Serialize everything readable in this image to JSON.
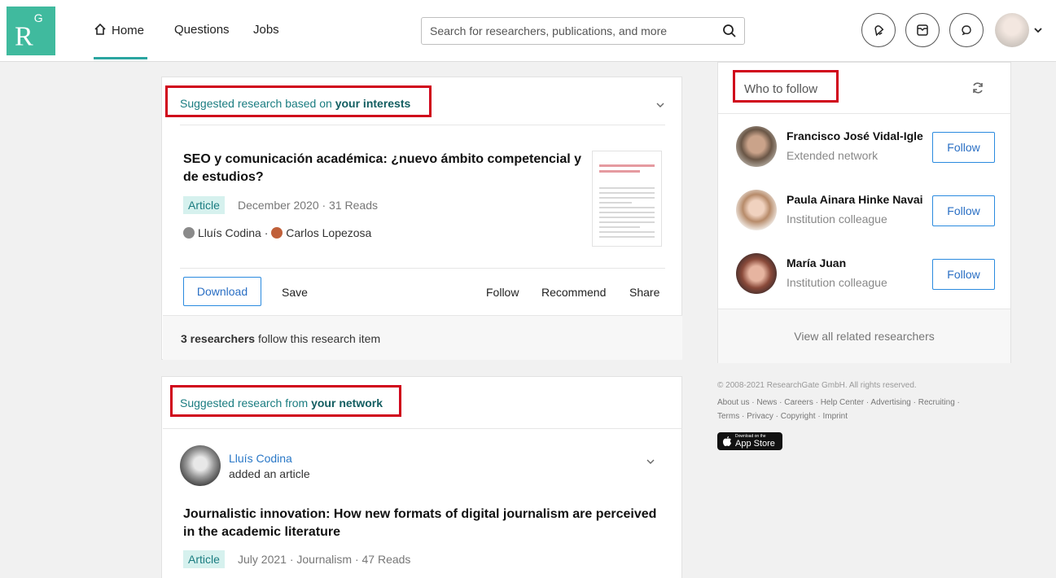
{
  "nav": {
    "logo": "R",
    "logo_sup": "G",
    "home": "Home",
    "questions": "Questions",
    "jobs": "Jobs",
    "search_placeholder": "Search for researchers, publications, and more"
  },
  "card_interests": {
    "header_prefix": "Suggested research based on ",
    "header_bold": "your interests",
    "title": "SEO y comunicación académica: ¿nuevo ámbito competencial y de estudios?",
    "tag": "Article",
    "meta": "December 2020 · 31 Reads",
    "author1": "Lluís Codina",
    "separator": " · ",
    "author2": "Carlos Lopezosa",
    "download": "Download",
    "save": "Save",
    "follow": "Follow",
    "recommend": "Recommend",
    "share": "Share",
    "followers_bold": "3 researchers",
    "followers_rest": " follow this research item"
  },
  "card_network": {
    "header_prefix": "Suggested research from ",
    "header_bold": "your network",
    "author": "Lluís Codina",
    "action": "added an article",
    "title": "Journalistic innovation: How new formats of digital journalism are perceived in the academic literature",
    "tag": "Article",
    "meta": "July 2021 · Journalism · 47 Reads"
  },
  "who_to_follow": {
    "title": "Who to follow",
    "people": [
      {
        "name": "Francisco José Vidal-Igle",
        "sub": "Extended network",
        "button": "Follow"
      },
      {
        "name": "Paula Ainara Hinke Navai",
        "sub": "Institution colleague",
        "button": "Follow"
      },
      {
        "name": "María Juan",
        "sub": "Institution colleague",
        "button": "Follow"
      }
    ],
    "view_all": "View all related researchers"
  },
  "footer": {
    "copyright": "© 2008-2021 ResearchGate GmbH. All rights reserved.",
    "links1": "About us · News · Careers · Help Center · Advertising · Recruiting ·",
    "links2": "Terms · Privacy · Copyright · Imprint",
    "appstore_small": "Download on the",
    "appstore": "App Store"
  },
  "colors": {
    "brand": "#40ba9e",
    "accent_teal": "#1a7c80",
    "link_blue": "#2a78c7",
    "highlight_red": "#d0021b"
  }
}
